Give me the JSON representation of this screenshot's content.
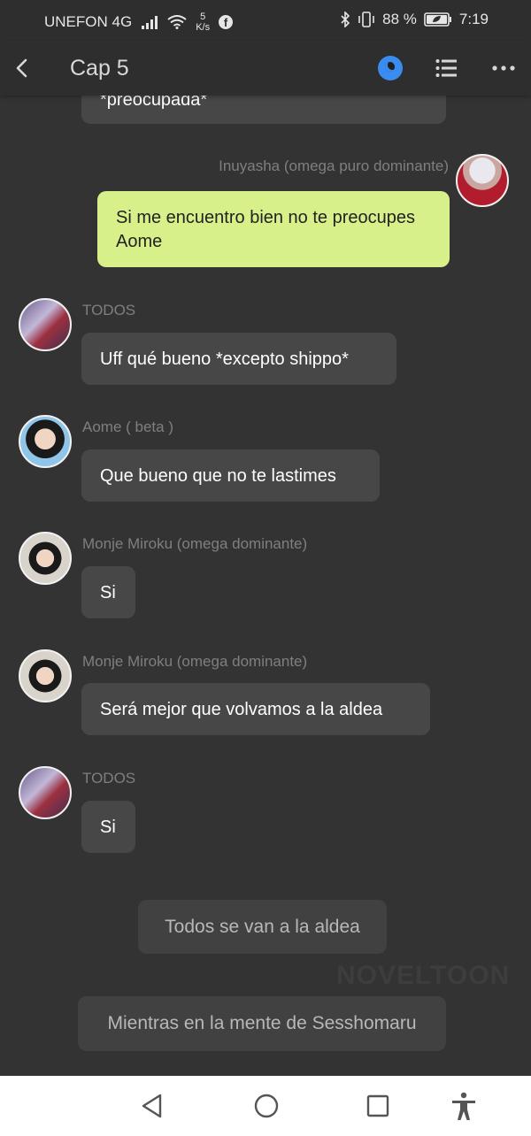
{
  "status_bar": {
    "carrier": "UNEFON 4G",
    "speed_value": "5",
    "speed_unit": "K/s",
    "battery": "88 %",
    "time": "7:19"
  },
  "header": {
    "title": "Cap 5",
    "icons": [
      "back-arrow-icon",
      "night-mode-icon",
      "chapter-list-icon",
      "more-options-icon"
    ],
    "accent_color": "#3b8cf0"
  },
  "messages": [
    {
      "speaker": "",
      "text": "*preocupada*",
      "side": "left"
    },
    {
      "speaker": "Inuyasha (omega puro dominante)",
      "text": "Si me encuentro bien no te preocupes Aome",
      "side": "right"
    },
    {
      "speaker": "TODOS",
      "text": "Uff qué bueno *excepto shippo*",
      "side": "left"
    },
    {
      "speaker": "Aome ( beta )",
      "text": "Que bueno que no te lastimes",
      "side": "left"
    },
    {
      "speaker": "Monje Miroku (omega dominante)",
      "text": "Si",
      "side": "left"
    },
    {
      "speaker": "Monje Miroku (omega dominante)",
      "text": "Será mejor que volvamos a la aldea",
      "side": "left"
    },
    {
      "speaker": "TODOS",
      "text": "Si",
      "side": "left"
    }
  ],
  "narrations": [
    "Todos se van a la aldea",
    "Mientras en la mente de Sesshomaru"
  ],
  "watermark": "NOVELTOON",
  "colors": {
    "background": "#333333",
    "bubble": "#474747",
    "my_bubble": "#d8f08a"
  }
}
